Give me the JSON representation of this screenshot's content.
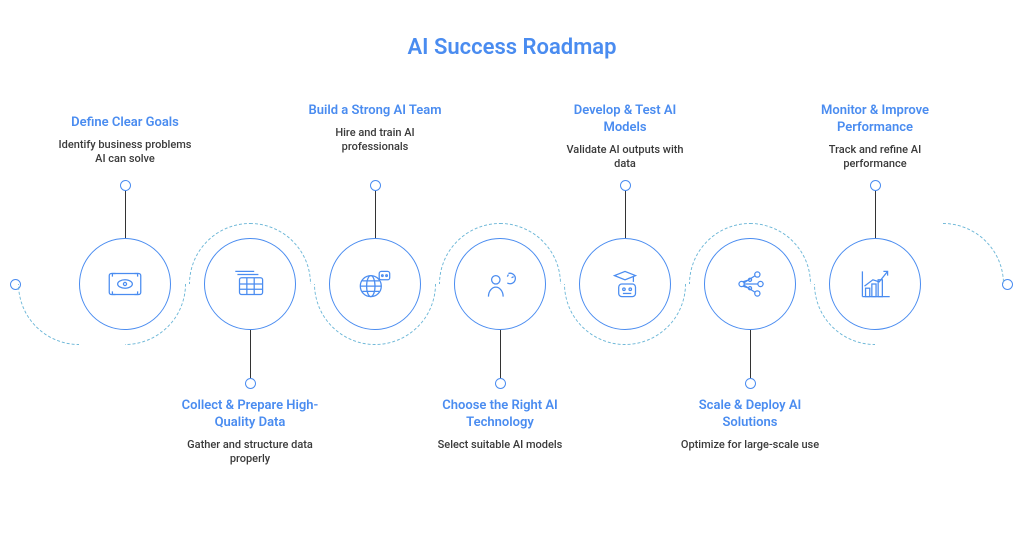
{
  "title": "AI Success Roadmap",
  "steps": [
    {
      "title": "Define Clear Goals",
      "sub": "Identify business problems AI can solve",
      "icon": "eye-frame-icon",
      "position": "top"
    },
    {
      "title": "Collect & Prepare High-Quality Data",
      "sub": "Gather and structure data properly",
      "icon": "data-table-icon",
      "position": "bottom"
    },
    {
      "title": "Build a Strong AI Team",
      "sub": "Hire and train AI professionals",
      "icon": "globe-chat-icon",
      "position": "top"
    },
    {
      "title": "Choose the Right AI Technology",
      "sub": "Select suitable AI models",
      "icon": "person-gears-icon",
      "position": "bottom"
    },
    {
      "title": "Develop & Test AI Models",
      "sub": "Validate AI outputs with data",
      "icon": "grad-robot-icon",
      "position": "top"
    },
    {
      "title": "Scale & Deploy AI Solutions",
      "sub": "Optimize for large-scale use",
      "icon": "network-icon",
      "position": "bottom"
    },
    {
      "title": "Monitor & Improve Performance",
      "sub": "Track and refine AI performance",
      "icon": "growth-chart-icon",
      "position": "top"
    }
  ],
  "colors": {
    "accent": "#4a8cf0",
    "arc": "#6fb8d8",
    "text": "#3a3a3a"
  }
}
